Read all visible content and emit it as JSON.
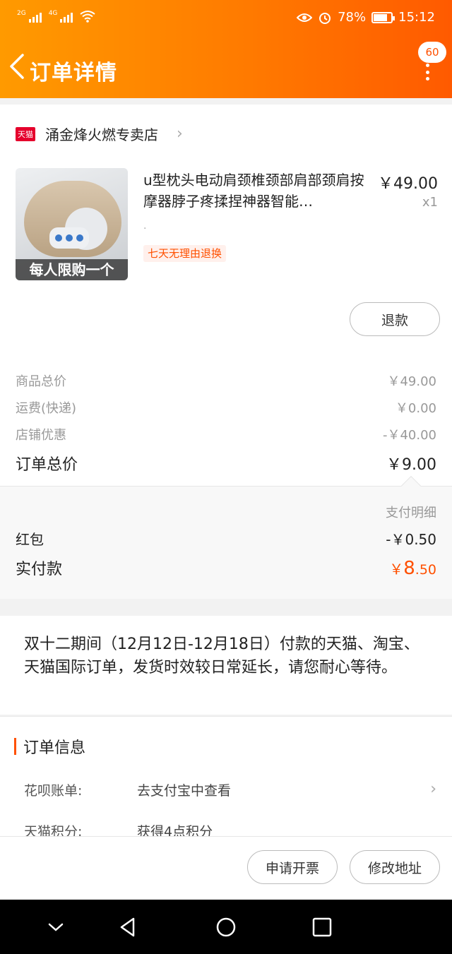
{
  "status_bar": {
    "net1": "2G",
    "net2": "4G",
    "battery": "78%",
    "battery_level": 0.78,
    "time": "15:12"
  },
  "header": {
    "title": "订单详情",
    "badge": "60"
  },
  "shop": {
    "logo_text": "天猫",
    "name": "涌金烽火燃专卖店"
  },
  "product": {
    "title": "u型枕头电动肩颈椎颈部肩部颈肩按摩器脖子疼揉捏神器智能…",
    "sub": ".",
    "price": "￥49.00",
    "qty": "x1",
    "tag": "七天无理由退换",
    "image_caption": "每人限购一个",
    "refund_label": "退款"
  },
  "summary": {
    "goods_label": "商品总价",
    "goods_value": "￥49.00",
    "shipping_label": "运费(快递)",
    "shipping_value": "￥0.00",
    "discount_label": "店铺优惠",
    "discount_value": "-￥40.00",
    "total_label": "订单总价",
    "total_value": "￥9.00"
  },
  "payment": {
    "detail_link": "支付明细",
    "redpacket_label": "红包",
    "redpacket_value": "-￥0.50",
    "paid_label": "实付款",
    "paid_currency": "￥",
    "paid_int": "8",
    "paid_dec": ".50"
  },
  "notice": {
    "text": "双十二期间（12月12日-12月18日）付款的天猫、淘宝、天猫国际订单，发货时效较日常延长，请您耐心等待。"
  },
  "order_info": {
    "title": "订单信息",
    "huabei_label": "花呗账单:",
    "huabei_value": "去支付宝中查看",
    "points_label": "天猫积分:",
    "points_value": "获得4点积分"
  },
  "actions": {
    "invoice": "申请开票",
    "change_address": "修改地址"
  },
  "colors": {
    "accent": "#ff5000",
    "header_start": "#ff9a00",
    "header_end": "#ff5a00"
  }
}
